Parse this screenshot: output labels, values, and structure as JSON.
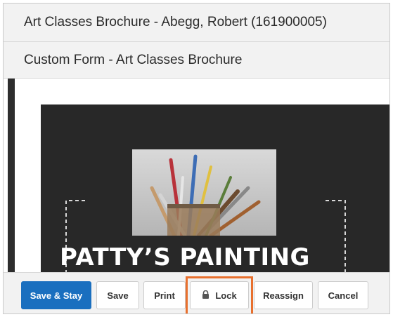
{
  "header": {
    "title": "Art Classes Brochure - Abegg, Robert (161900005)",
    "subtitle": "Custom Form - Art Classes Brochure"
  },
  "brochure": {
    "title": "PATTY’S PAINTING"
  },
  "toolbar": {
    "save_stay_label": "Save & Stay",
    "save_label": "Save",
    "print_label": "Print",
    "lock_label": "Lock",
    "reassign_label": "Reassign",
    "cancel_label": "Cancel"
  },
  "icons": {
    "lock": "lock-icon"
  },
  "colors": {
    "primary": "#1a6fbf",
    "highlight": "#e8702e",
    "brochure_bg": "#282828"
  }
}
